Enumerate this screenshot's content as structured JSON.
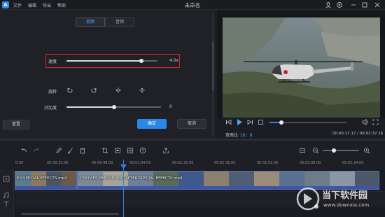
{
  "app": {
    "logo_letter": "A",
    "window_title": "未命名",
    "menu": [
      "文件",
      "编辑",
      "导出",
      "帮助"
    ]
  },
  "colors": {
    "accent": "#2b86e6",
    "highlight_box": "#d6272c",
    "panel_bg": "#202127",
    "clip_border": "#5a6fb0"
  },
  "edit_panel": {
    "tabs": [
      {
        "label": "视频",
        "active": true
      },
      {
        "label": "音频",
        "active": false
      }
    ],
    "speed": {
      "label": "速度",
      "value_text": "4.0x",
      "level": 0.82
    },
    "rotate": {
      "label": "旋转",
      "icons": [
        "rotate-left-icon",
        "rotate-right-icon",
        "flip-horizontal-icon",
        "flip-vertical-icon"
      ]
    },
    "contrast": {
      "label": "对比度",
      "value_text": "0",
      "level": 0.5
    },
    "buttons": {
      "reset": "重置",
      "ok": "确定",
      "cancel": "取消"
    }
  },
  "preview": {
    "progress_level": 0.15,
    "aspect_label": "宽高比",
    "aspect_value": "16：9",
    "timecode": "00:00:17.17 / 00:02:37.16"
  },
  "timeline": {
    "ruler_labels": [
      "0.00",
      "00:00:32.00",
      "00:00:48.00",
      "00:01:04.00",
      "00:01:20.00",
      "00:01:36.00",
      "00:01:52.00",
      "00:02:08.00",
      "00:02:24.00"
    ],
    "zoom_level": 0.3,
    "clips": [
      {
        "label": "ER SPECIAL EFFECTS.mp4"
      },
      {
        "label": "7 MOVIES BEFORE AND AFTER SPECIAL EFFECTS.mp4"
      }
    ]
  },
  "watermark": {
    "site_name": "当下软件园",
    "url": "www.downxia.com"
  }
}
